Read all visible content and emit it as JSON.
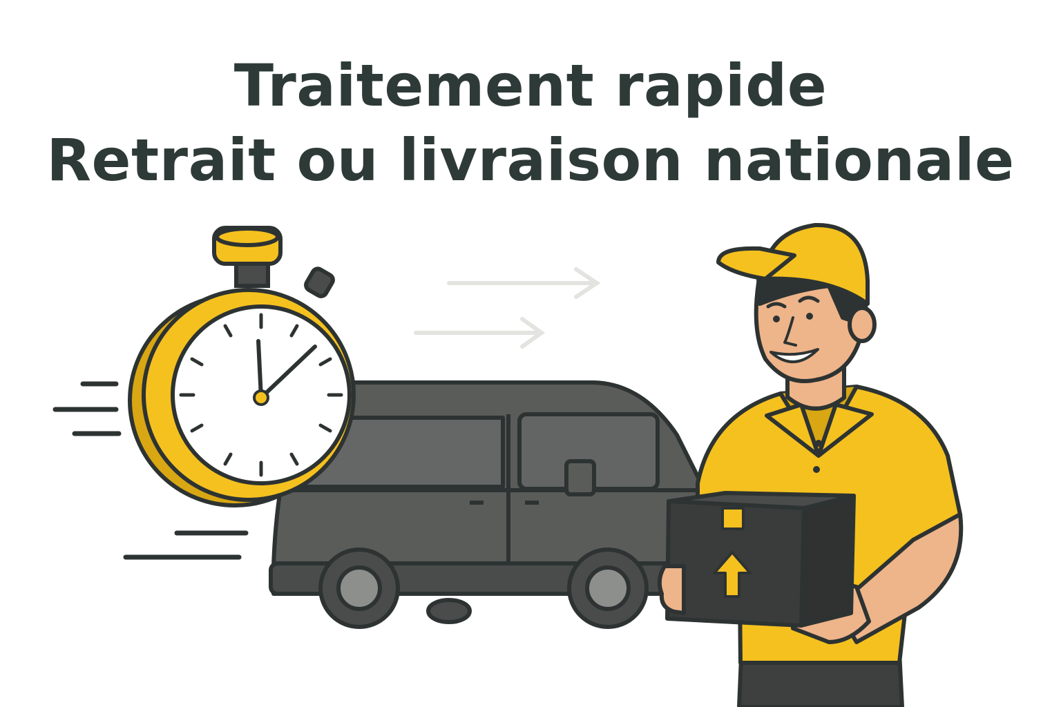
{
  "headline": {
    "line1": "Traitement rapide",
    "line2": "Retrait ou livraison nationale"
  },
  "illustration": {
    "items": [
      "stopwatch-icon",
      "delivery-van-icon",
      "courier-figure",
      "parcel-box-icon",
      "up-arrow-icon",
      "motion-lines"
    ]
  },
  "colors": {
    "text": "#2e3a37",
    "yellow": "#f5c11f",
    "yellow_dark": "#d9a713",
    "van": "#5a5c5a",
    "van_dark": "#3e403f",
    "outline": "#2d3332",
    "skin": "#eeb48a",
    "box": "#3a3c3b"
  }
}
